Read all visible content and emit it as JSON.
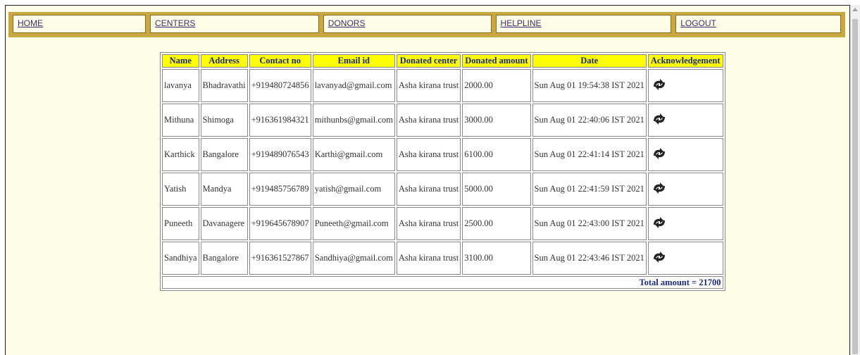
{
  "nav": {
    "items": [
      "HOME",
      "CENTERS",
      "DONORS",
      "HELPLINE",
      "LOGOUT"
    ]
  },
  "table": {
    "headers": [
      "Name",
      "Address",
      "Contact no",
      "Email id",
      "Donated center",
      "Donated amount",
      "Date",
      "Acknowledgement"
    ],
    "rows": [
      [
        "lavanya",
        "Bhadravathi",
        "+919480724856",
        "lavanyad@gmail.com",
        "Asha kirana trust",
        "2000.00",
        "Sun Aug 01 19:54:38 IST 2021"
      ],
      [
        "Mithuna",
        "Shimoga",
        "+916361984321",
        "mithunbs@gmail.com",
        "Asha kirana trust",
        "3000.00",
        "Sun Aug 01 22:40:06 IST 2021"
      ],
      [
        "Karthick",
        "Bangalore",
        "+919489076543",
        "Karthi@gmail.com",
        "Asha kirana trust",
        "6100.00",
        "Sun Aug 01 22:41:14 IST 2021"
      ],
      [
        "Yatish",
        "Mandya",
        "+919485756789",
        "yatish@gmail.com",
        "Asha kirana trust",
        "5000.00",
        "Sun Aug 01 22:41:59 IST 2021"
      ],
      [
        "Puneeth",
        "Davanagere",
        "+919645678907",
        "Puneeth@gmail.com",
        "Asha kirana trust",
        "2500.00",
        "Sun Aug 01 22:43:00 IST 2021"
      ],
      [
        "Sandhiya",
        "Bangalore",
        "+916361527867",
        "Sandhiya@gmail.com",
        "Asha kirana trust",
        "3100.00",
        "Sun Aug 01 22:43:46 IST 2021"
      ]
    ],
    "total_label": "Total amount = 21700",
    "ack_icon": "refresh-arrows-icon"
  },
  "colors": {
    "nav_bar": "#c9a742",
    "header_bg": "#ffff00",
    "header_text": "#1a2b7a",
    "page_bg": "#fefee8"
  }
}
